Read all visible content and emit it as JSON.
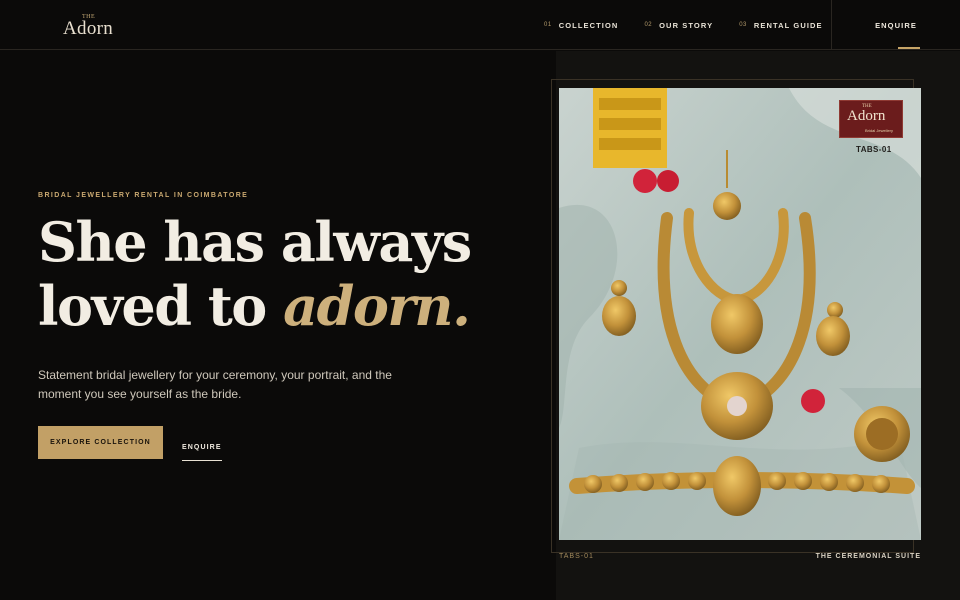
{
  "brand": {
    "logo_small": "THE",
    "logo_word": "Adorn"
  },
  "nav": {
    "items": [
      {
        "num": "01",
        "label": "COLLECTION"
      },
      {
        "num": "02",
        "label": "OUR STORY"
      },
      {
        "num": "03",
        "label": "RENTAL GUIDE"
      }
    ],
    "enquire": "ENQUIRE"
  },
  "hero": {
    "eyebrow": "BRIDAL JEWELLERY RENTAL IN COIMBATORE",
    "headline_line1": "She has always",
    "headline_line2_plain": "loved to ",
    "headline_line2_accent": "adorn.",
    "lede": "Statement bridal jewellery for your ceremony, your portrait, and the moment you see yourself as the bride.",
    "cta_primary": "EXPLORE COLLECTION",
    "cta_secondary": "ENQUIRE"
  },
  "feature": {
    "photo_tag_small": "THE",
    "photo_tag_word": "Adorn",
    "photo_tag_sub": "Bridal Jewellery",
    "photo_code": "TABS-01",
    "caption_code": "TABS-01",
    "caption_title": "THE CEREMONIAL SUITE"
  },
  "colors": {
    "background": "#0b0a09",
    "accent_gold": "#c2a066",
    "text_light": "#f2ede3"
  }
}
